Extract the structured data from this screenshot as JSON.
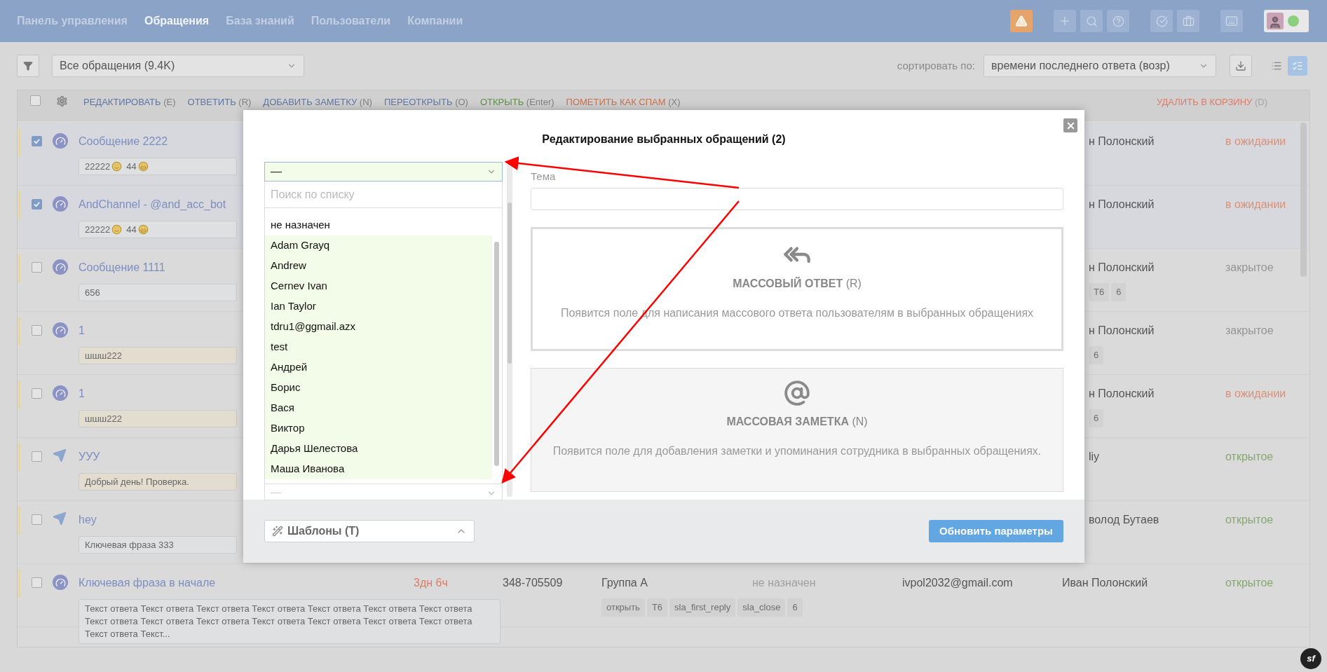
{
  "nav": {
    "items": [
      {
        "label": "Панель управления",
        "selected": false
      },
      {
        "label": "Обращения",
        "selected": true
      },
      {
        "label": "База знаний",
        "selected": false
      },
      {
        "label": "Пользователи",
        "selected": false
      },
      {
        "label": "Компании",
        "selected": false
      }
    ]
  },
  "toolbar": {
    "filter_select": "Все обращения (9.4K)",
    "sort_label": "сортировать по:",
    "sort_select": "времени последнего ответа (возр)",
    "views": [
      {
        "kind": "list",
        "selected": false
      },
      {
        "kind": "detailed",
        "selected": true
      }
    ]
  },
  "bulk_bar": {
    "checked": false,
    "actions": [
      {
        "label": "РЕДАКТИРОВАТЬ",
        "key": "(E)",
        "kind": "normal"
      },
      {
        "label": "ОТВЕТИТЬ",
        "key": "(R)",
        "kind": "normal"
      },
      {
        "label": "ДОБАВИТЬ ЗАМЕТКУ",
        "key": "(N)",
        "kind": "normal"
      },
      {
        "label": "ПЕРЕОТКРЫТЬ",
        "key": "(O)",
        "kind": "normal"
      },
      {
        "label": "ОТКРЫТЬ",
        "key": "(Enter)",
        "kind": "success"
      },
      {
        "label": "ПОМЕТИТЬ КАК СПАМ",
        "key": "(X)",
        "kind": "warning"
      }
    ],
    "delete": {
      "label": "УДАЛИТЬ В КОРЗИНУ",
      "key": "(D)"
    }
  },
  "rows": [
    {
      "kind": "widget",
      "checked": true,
      "title": "Сообщение 2222",
      "preview": {
        "kind": "plain",
        "parts": [
          {
            "text": "22222",
            "kind": "smile"
          },
          {
            "text": "44",
            "kind": "grin"
          }
        ]
      },
      "assignee": "н Полонский",
      "status": {
        "label": "в ожидании",
        "kind": "waiting"
      }
    },
    {
      "kind": "widget",
      "checked": true,
      "title": "AndChannel - @and_acc_bot",
      "preview": {
        "kind": "plain",
        "parts": [
          {
            "text": "22222",
            "kind": "smile"
          },
          {
            "text": "44",
            "kind": "grin"
          }
        ]
      },
      "assignee": "н Полонский",
      "status": {
        "label": "в ожидании",
        "kind": "waiting"
      }
    },
    {
      "kind": "widget",
      "checked": false,
      "title": "Сообщение 1111",
      "preview": {
        "kind": "plain",
        "parts": [
          {
            "text": "656"
          }
        ]
      },
      "assignee": "н Полонский",
      "tags": [
        "Т6",
        "6"
      ],
      "status": {
        "label": "закрытое",
        "kind": "closed"
      }
    },
    {
      "kind": "widget",
      "checked": false,
      "title": "1",
      "preview": {
        "kind": "highlight",
        "parts": [
          {
            "text": "шшш222"
          }
        ]
      },
      "assignee": "н Полонский",
      "tags": [
        "6"
      ],
      "status": {
        "label": "закрытое",
        "kind": "closed"
      }
    },
    {
      "kind": "widget",
      "checked": false,
      "title": "1",
      "preview": {
        "kind": "highlight",
        "parts": [
          {
            "text": "шшш222"
          }
        ]
      },
      "assignee": "н Полонский",
      "tags": [
        "6"
      ],
      "status": {
        "label": "в ожидании",
        "kind": "waiting"
      }
    },
    {
      "kind": "telegram",
      "checked": false,
      "title": "УУУ",
      "preview": {
        "kind": "highlight",
        "parts": [
          {
            "text": "Добрый день! Проверка."
          }
        ]
      },
      "assignee": "liy",
      "status": {
        "label": "открытое",
        "kind": "open"
      }
    },
    {
      "kind": "telegram",
      "checked": false,
      "title": "hey",
      "preview": {
        "kind": "plain",
        "parts": [
          {
            "text": "Ключевая фраза 333"
          }
        ]
      },
      "assignee": "волод Бутаев",
      "status": {
        "label": "открытое",
        "kind": "open"
      }
    },
    {
      "kind": "widget",
      "checked": false,
      "title": "Ключевая фраза в начале",
      "preview": {
        "kind": "plain",
        "parts": [
          {
            "text": "Текст ответа Текст ответа Текст ответа Текст ответа Текст ответа Текст ответа Текст ответа Текст ответа Текст ответа Текст ответа Текст ответа Текст ответа Текст ответа Текст ответа Текст ответа Текст..."
          }
        ]
      },
      "time": "3дн 6ч",
      "phone": "348-705509",
      "group": "Группа А",
      "responsible": "не назначен",
      "email": "ivpol2032@gmail.com",
      "assignee": "Иван Полонский",
      "tags": [
        "открыть",
        "Т6",
        "sla_first_reply",
        "sla_close",
        "6"
      ],
      "status": {
        "label": "открытое",
        "kind": "open"
      }
    }
  ],
  "modal": {
    "title": "Редактирование выбранных обращений (2)",
    "assignee_select": {
      "value": "—",
      "search_placeholder": "Поиск по списку",
      "options": [
        {
          "label": "не назначен",
          "selected": false
        },
        {
          "label": "Adam Grayq",
          "selected": true
        },
        {
          "label": "Andrew",
          "selected": true
        },
        {
          "label": "Cernev Ivan",
          "selected": true
        },
        {
          "label": "Ian Taylor",
          "selected": true
        },
        {
          "label": "tdru1@ggmail.azx",
          "selected": true
        },
        {
          "label": "test",
          "selected": true
        },
        {
          "label": "Андрей",
          "selected": true
        },
        {
          "label": "Борис",
          "selected": true
        },
        {
          "label": "Вася",
          "selected": true
        },
        {
          "label": "Виктор",
          "selected": true
        },
        {
          "label": "Дарья Шелестова",
          "selected": true
        },
        {
          "label": "Маша Иванова",
          "selected": true
        }
      ]
    },
    "second_select": {
      "value": "—"
    },
    "subject_label": "Тема",
    "cards": [
      {
        "kind": "reply",
        "title": "МАССОВЫЙ ОТВЕТ",
        "key": "(R)",
        "description": "Появится поле для написания массового ответа пользователям в выбранных обращениях",
        "active": true
      },
      {
        "kind": "note",
        "title": "МАССОВАЯ ЗАМЕТКА",
        "key": "(N)",
        "description": "Появится поле для добавления заметки и упоминания сотрудника в выбранных обращениях.",
        "active": false
      }
    ],
    "templates_button": "Шаблоны (T)",
    "submit_button": "Обновить параметры"
  },
  "debug_badge": "sf"
}
